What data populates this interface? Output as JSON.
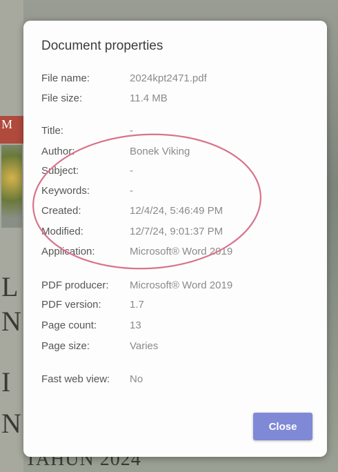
{
  "dialog": {
    "title": "Document properties",
    "close_label": "Close"
  },
  "groups": [
    {
      "rows": [
        {
          "label": "File name:",
          "value": "2024kpt2471.pdf"
        },
        {
          "label": "File size:",
          "value": "11.4 MB"
        }
      ]
    },
    {
      "rows": [
        {
          "label": "Title:",
          "value": "-"
        },
        {
          "label": "Author:",
          "value": "Bonek Viking"
        },
        {
          "label": "Subject:",
          "value": "-"
        },
        {
          "label": "Keywords:",
          "value": "-"
        },
        {
          "label": "Created:",
          "value": "12/4/24, 5:46:49 PM"
        },
        {
          "label": "Modified:",
          "value": "12/7/24, 9:01:37 PM"
        },
        {
          "label": "Application:",
          "value": "Microsoft® Word 2019"
        }
      ]
    },
    {
      "rows": [
        {
          "label": "PDF producer:",
          "value": "Microsoft® Word 2019"
        },
        {
          "label": "PDF version:",
          "value": "1.7"
        },
        {
          "label": "Page count:",
          "value": "13"
        },
        {
          "label": "Page size:",
          "value": "Varies"
        }
      ]
    },
    {
      "rows": [
        {
          "label": "Fast web view:",
          "value": "No"
        }
      ]
    }
  ],
  "background": {
    "letters": [
      "M",
      "L",
      "N",
      "I",
      "N"
    ],
    "bottom_text": "TAHUN 2024"
  },
  "colors": {
    "annotation_ellipse": "#d9728c",
    "close_button": "#8089d6"
  }
}
